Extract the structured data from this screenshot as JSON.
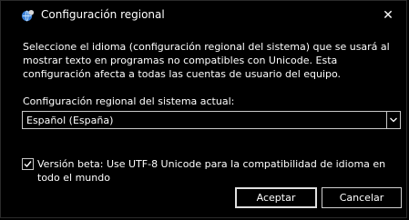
{
  "window": {
    "title": "Configuración regional",
    "close_label": "✕"
  },
  "description": "Seleccione el idioma (configuración regional del sistema) que se usará al mostrar texto en programas no compatibles con Unicode. Esta configuración afecta a todas las cuentas de usuario del equipo.",
  "current_locale": {
    "label": "Configuración regional del sistema actual:",
    "selected": "Español (España)"
  },
  "beta": {
    "checked": true,
    "label": "Versión beta: Use UTF-8 Unicode para la compatibilidad de idioma en todo el mundo"
  },
  "buttons": {
    "accept": "Aceptar",
    "cancel": "Cancelar"
  }
}
